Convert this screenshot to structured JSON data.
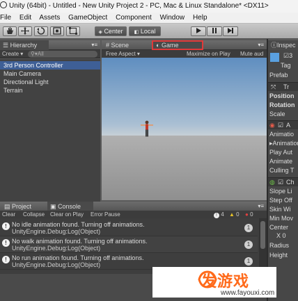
{
  "window": {
    "title": "Unity (64bit) - Untitled - New Unity Project 2 - PC, Mac & Linux Standalone* <DX11>"
  },
  "menu": [
    "File",
    "Edit",
    "Assets",
    "GameObject",
    "Component",
    "Window",
    "Help"
  ],
  "toolbar": {
    "pivot": "Center",
    "space": "Local"
  },
  "hierarchy": {
    "tab": "Hierarchy",
    "create": "Create",
    "search_placeholder": "All",
    "items": [
      "3rd Person Controller",
      "Main Camera",
      "Directional Light",
      "Terrain"
    ]
  },
  "scene_tabs": {
    "scene": "Scene",
    "game": "Game"
  },
  "game_bar": {
    "aspect": "Free Aspect",
    "maximize": "Maximize on Play",
    "mute": "Mute aud"
  },
  "console": {
    "project_tab": "Project",
    "console_tab": "Console",
    "buttons": [
      "Clear",
      "Collapse",
      "Clear on Play",
      "Error Pause"
    ],
    "counts": {
      "log": "4",
      "warn": "0",
      "error": "0"
    },
    "entries": [
      {
        "line1": "No idle animation found. Turning off animations.",
        "line2": "UnityEngine.Debug:Log(Object)",
        "count": "1"
      },
      {
        "line1": "No walk animation found. Turning off animations.",
        "line2": "UnityEngine.Debug:Log(Object)",
        "count": "1"
      },
      {
        "line1": "No run animation found. Turning off animations.",
        "line2": "UnityEngine.Debug:Log(Object)",
        "count": "1"
      }
    ]
  },
  "inspector": {
    "tab": "Inspec",
    "tag": "Tag",
    "prefab": "Prefab",
    "transform": "Tr",
    "position": "Position",
    "rotation": "Rotation",
    "scale": "Scale",
    "animation_section": "A",
    "animation": "Animatio",
    "animations": "Animation",
    "play_auto": "Play Aut",
    "animate": "Animate",
    "culling": "Culling T",
    "controller_section": "Ch",
    "slope": "Slope Li",
    "step": "Step Off",
    "skin": "Skin Wi",
    "min_move": "Min Mov",
    "center": "Center",
    "center_x": "X 0",
    "radius": "Radius",
    "height": "Height"
  },
  "watermark": {
    "brand": "发游戏",
    "url": "www.fayouxi.com"
  }
}
